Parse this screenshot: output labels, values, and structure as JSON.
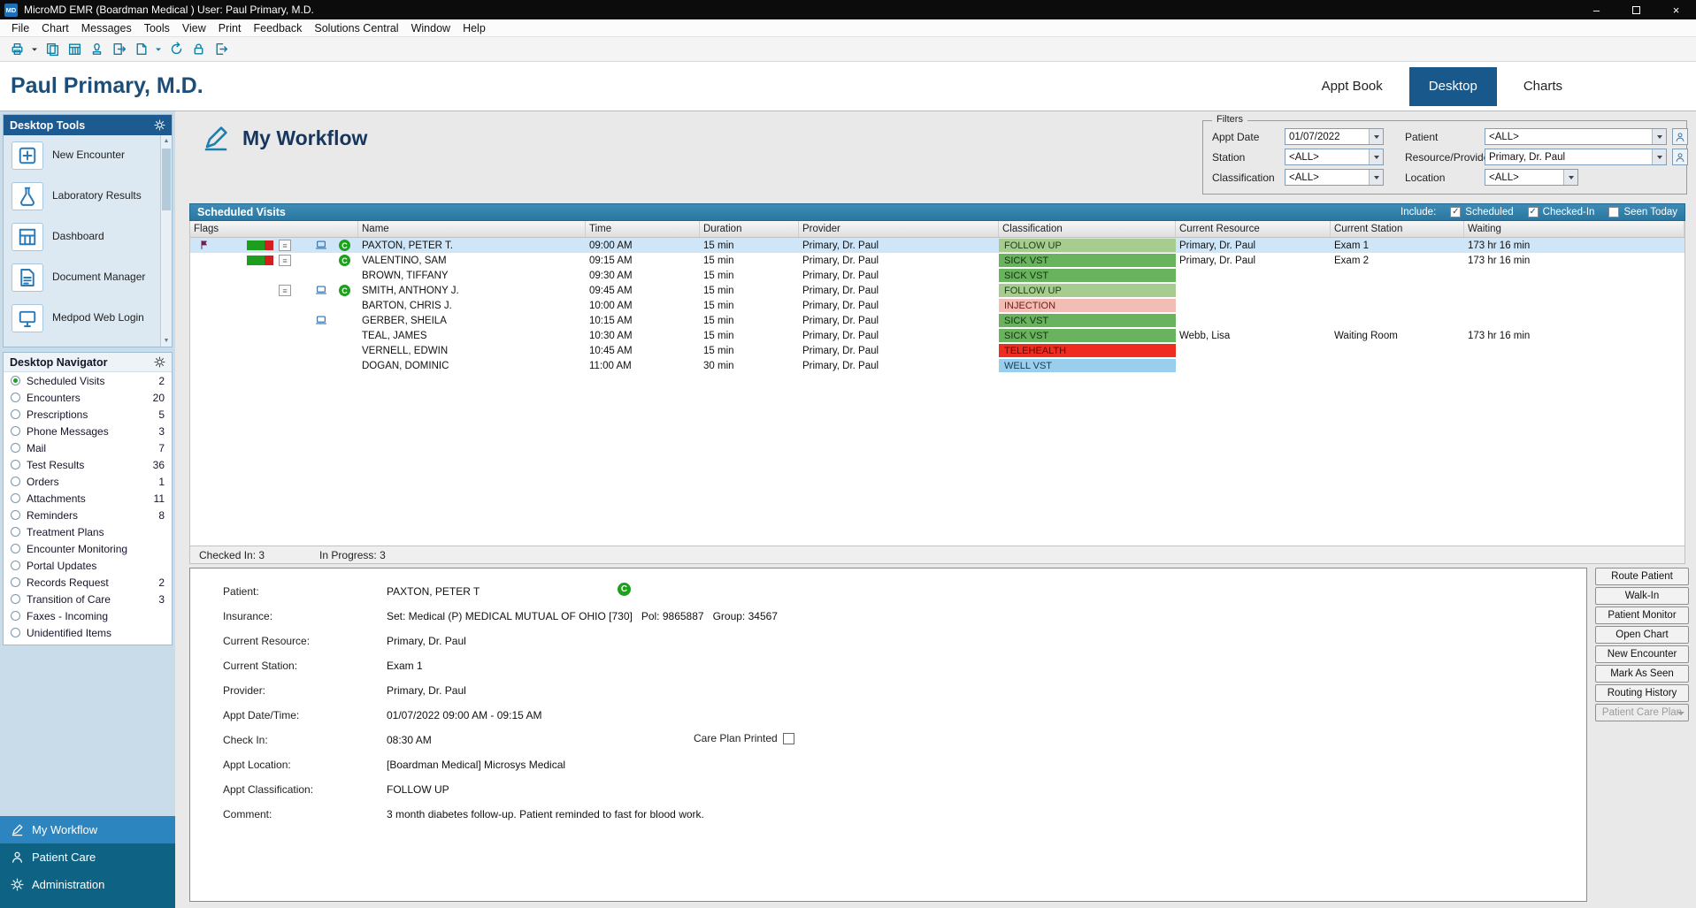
{
  "window": {
    "logo": "MD",
    "title": "MicroMD EMR (Boardman Medical )  User: Paul Primary, M.D."
  },
  "window_controls": [
    "minimize",
    "maximize",
    "close"
  ],
  "menu_bar": [
    "File",
    "Chart",
    "Messages",
    "Tools",
    "View",
    "Print",
    "Feedback",
    "Solutions Central",
    "Window",
    "Help"
  ],
  "toolbar_icons": [
    {
      "name": "print-icon",
      "type": "print"
    },
    {
      "name": "print-options-dropdown-icon",
      "type": "dropdown"
    },
    {
      "name": "batch-print-icon",
      "type": "pages"
    },
    {
      "name": "schedule-grid-icon",
      "type": "calendar"
    },
    {
      "name": "sign-encounter-icon",
      "type": "stamp"
    },
    {
      "name": "import-document-icon",
      "type": "export"
    },
    {
      "name": "new-document-icon",
      "type": "doc"
    },
    {
      "name": "document-options-dropdown-icon",
      "type": "dropdown2"
    },
    {
      "name": "refresh-icon",
      "type": "refresh"
    },
    {
      "name": "lock-icon",
      "type": "lock"
    },
    {
      "name": "logout-icon",
      "type": "exit"
    }
  ],
  "header": {
    "user_name": "Paul Primary, M.D.",
    "tabs": [
      {
        "label": "Appt Book",
        "active": false
      },
      {
        "label": "Desktop",
        "active": true
      },
      {
        "label": "Charts",
        "active": false
      }
    ]
  },
  "desktop_tools": {
    "title": "Desktop Tools",
    "items": [
      {
        "label": "New Encounter",
        "icon": "new-encounter-icon",
        "type": "plusdoc"
      },
      {
        "label": "Laboratory Results",
        "icon": "laboratory-results-icon",
        "type": "flask"
      },
      {
        "label": "Dashboard",
        "icon": "dashboard-icon",
        "type": "grid"
      },
      {
        "label": "Document Manager",
        "icon": "document-manager-icon",
        "type": "dms"
      },
      {
        "label": "Medpod Web Login",
        "icon": "medpod-web-login-icon",
        "type": "monitor"
      }
    ]
  },
  "desktop_navigator": {
    "title": "Desktop Navigator",
    "items": [
      {
        "label": "Scheduled Visits",
        "count": "2",
        "selected": true
      },
      {
        "label": "Encounters",
        "count": "20",
        "selected": false
      },
      {
        "label": "Prescriptions",
        "count": "5",
        "selected": false
      },
      {
        "label": "Phone Messages",
        "count": "3",
        "selected": false
      },
      {
        "label": "Mail",
        "count": "7",
        "selected": false
      },
      {
        "label": "Test Results",
        "count": "36",
        "selected": false
      },
      {
        "label": "Orders",
        "count": "1",
        "selected": false
      },
      {
        "label": "Attachments",
        "count": "11",
        "selected": false
      },
      {
        "label": "Reminders",
        "count": "8",
        "selected": false
      },
      {
        "label": "Treatment Plans",
        "count": "",
        "selected": false
      },
      {
        "label": "Encounter Monitoring",
        "count": "",
        "selected": false
      },
      {
        "label": "Portal Updates",
        "count": "",
        "selected": false
      },
      {
        "label": "Records Request",
        "count": "2",
        "selected": false
      },
      {
        "label": "Transition of Care",
        "count": "3",
        "selected": false
      },
      {
        "label": "Faxes - Incoming",
        "count": "",
        "selected": false
      },
      {
        "label": "Unidentified Items",
        "count": "",
        "selected": false
      }
    ]
  },
  "sidebar_nav": [
    {
      "label": "My Workflow",
      "icon": "my-workflow-icon",
      "type": "pen",
      "active": true
    },
    {
      "label": "Patient Care",
      "icon": "patient-care-icon",
      "type": "person",
      "active": false
    },
    {
      "label": "Administration",
      "icon": "administration-icon",
      "type": "gear",
      "active": false
    }
  ],
  "workflow": {
    "title": "My Workflow"
  },
  "filters": {
    "legend": "Filters",
    "rows": [
      [
        {
          "label": "Appt Date",
          "value": "01/07/2022",
          "lookup": false,
          "short": false
        },
        {
          "label": "Patient",
          "value": "<ALL>",
          "lookup": true,
          "short": false
        }
      ],
      [
        {
          "label": "Station",
          "value": "<ALL>",
          "lookup": false,
          "short": false
        },
        {
          "label": "Resource/Provider",
          "value": "Primary, Dr. Paul",
          "lookup": true,
          "short": false
        }
      ],
      [
        {
          "label": "Classification",
          "value": "<ALL>",
          "lookup": false,
          "short": false
        },
        {
          "label": "Location",
          "value": "<ALL>",
          "lookup": false,
          "short": true
        }
      ]
    ]
  },
  "scheduled_visits": {
    "title": "Scheduled Visits",
    "include_label": "Include:",
    "include_options": [
      {
        "label": "Scheduled",
        "checked": true
      },
      {
        "label": "Checked-In",
        "checked": true
      },
      {
        "label": "Seen Today",
        "checked": false
      }
    ],
    "columns": [
      "Flags",
      "Name",
      "Time",
      "Duration",
      "Provider",
      "Classification",
      "Current Resource",
      "Current Station",
      "Waiting"
    ],
    "classification_colors": {
      "FOLLOW UP": {
        "bg": "#a6cc8f",
        "fg": "#1d3d14"
      },
      "SICK VST": {
        "bg": "#69b25e",
        "fg": "#14330f"
      },
      "INJECTION": {
        "bg": "#f2bdb5",
        "fg": "#6e2018"
      },
      "TELEHEALTH": {
        "bg": "#ee2c20",
        "fg": "#5e0a05"
      },
      "WELL VST": {
        "bg": "#99cfec",
        "fg": "#103c57"
      }
    },
    "rows": [
      {
        "selected": true,
        "flags": {
          "flag": true,
          "status_bar": true,
          "note": true,
          "monitor": true,
          "checked_in": true
        },
        "name": "PAXTON, PETER T.",
        "time": "09:00 AM",
        "duration": "15 min",
        "provider": "Primary, Dr. Paul",
        "classification": "FOLLOW UP",
        "resource": "Primary, Dr. Paul",
        "station": "Exam 1",
        "waiting": "173 hr 16 min"
      },
      {
        "selected": false,
        "flags": {
          "flag": false,
          "status_bar": true,
          "note": true,
          "monitor": false,
          "checked_in": true
        },
        "name": "VALENTINO, SAM",
        "time": "09:15 AM",
        "duration": "15 min",
        "provider": "Primary, Dr. Paul",
        "classification": "SICK VST",
        "resource": "Primary, Dr. Paul",
        "station": "Exam 2",
        "waiting": "173 hr 16 min"
      },
      {
        "selected": false,
        "flags": {},
        "name": "BROWN, TIFFANY",
        "time": "09:30 AM",
        "duration": "15 min",
        "provider": "Primary, Dr. Paul",
        "classification": "SICK VST",
        "resource": "",
        "station": "",
        "waiting": ""
      },
      {
        "selected": false,
        "flags": {
          "note": true,
          "monitor": true,
          "checked_in": true
        },
        "name": "SMITH, ANTHONY J.",
        "time": "09:45 AM",
        "duration": "15 min",
        "provider": "Primary, Dr. Paul",
        "classification": "FOLLOW UP",
        "resource": "",
        "station": "",
        "waiting": ""
      },
      {
        "selected": false,
        "flags": {},
        "name": "BARTON, CHRIS J.",
        "time": "10:00 AM",
        "duration": "15 min",
        "provider": "Primary, Dr. Paul",
        "classification": "INJECTION",
        "resource": "",
        "station": "",
        "waiting": ""
      },
      {
        "selected": false,
        "flags": {
          "monitor": true
        },
        "name": "GERBER, SHEILA",
        "time": "10:15 AM",
        "duration": "15 min",
        "provider": "Primary, Dr. Paul",
        "classification": "SICK VST",
        "resource": "",
        "station": "",
        "waiting": ""
      },
      {
        "selected": false,
        "flags": {},
        "name": "TEAL, JAMES",
        "time": "10:30 AM",
        "duration": "15 min",
        "provider": "Primary, Dr. Paul",
        "classification": "SICK VST",
        "resource": "Webb,  Lisa",
        "station": "Waiting Room",
        "waiting": "173 hr 16 min"
      },
      {
        "selected": false,
        "flags": {},
        "name": "VERNELL, EDWIN",
        "time": "10:45 AM",
        "duration": "15 min",
        "provider": "Primary, Dr. Paul",
        "classification": "TELEHEALTH",
        "resource": "",
        "station": "",
        "waiting": ""
      },
      {
        "selected": false,
        "flags": {},
        "name": "DOGAN, DOMINIC",
        "time": "11:00 AM",
        "duration": "30 min",
        "provider": "Primary, Dr. Paul",
        "classification": "WELL VST",
        "resource": "",
        "station": "",
        "waiting": ""
      }
    ],
    "status": {
      "checked_in": "Checked In: 3",
      "in_progress": "In Progress: 3"
    }
  },
  "detail": {
    "checked_in_glyph": "C",
    "rows": [
      {
        "label": "Patient:",
        "value": "PAXTON, PETER T",
        "checked_in_badge": true
      },
      {
        "label": "Insurance:",
        "value": "Set: Medical (P) MEDICAL MUTUAL OF OHIO [730]   Pol: 9865887   Group: 34567"
      },
      {
        "label": "Current Resource:",
        "value": "Primary, Dr. Paul"
      },
      {
        "label": "Current Station:",
        "value": "Exam 1"
      },
      {
        "label": "Provider:",
        "value": "Primary, Dr. Paul"
      },
      {
        "label": "Appt Date/Time:",
        "value": "01/07/2022 09:00 AM - 09:15 AM"
      },
      {
        "label": "Check In:",
        "value": "08:30 AM",
        "extra_label": "Care Plan Printed",
        "extra_checked": false
      },
      {
        "label": "Appt Location:",
        "value": "[Boardman Medical] Microsys Medical"
      },
      {
        "label": "Appt Classification:",
        "value": "FOLLOW UP"
      },
      {
        "label": "Comment:",
        "value": "3 month diabetes follow-up. Patient reminded to fast for blood work."
      }
    ]
  },
  "actions": [
    {
      "label": "Route Patient",
      "disabled": false,
      "dropdown": false
    },
    {
      "label": "Walk-In",
      "disabled": false,
      "dropdown": false
    },
    {
      "label": "Patient Monitor",
      "disabled": false,
      "dropdown": false
    },
    {
      "label": "Open Chart",
      "disabled": false,
      "dropdown": false
    },
    {
      "label": "New Encounter",
      "disabled": false,
      "dropdown": false
    },
    {
      "label": "Mark As Seen",
      "disabled": false,
      "dropdown": false
    },
    {
      "label": "Routing History",
      "disabled": false,
      "dropdown": false
    },
    {
      "label": "Patient Care Plan",
      "disabled": true,
      "dropdown": true
    }
  ]
}
